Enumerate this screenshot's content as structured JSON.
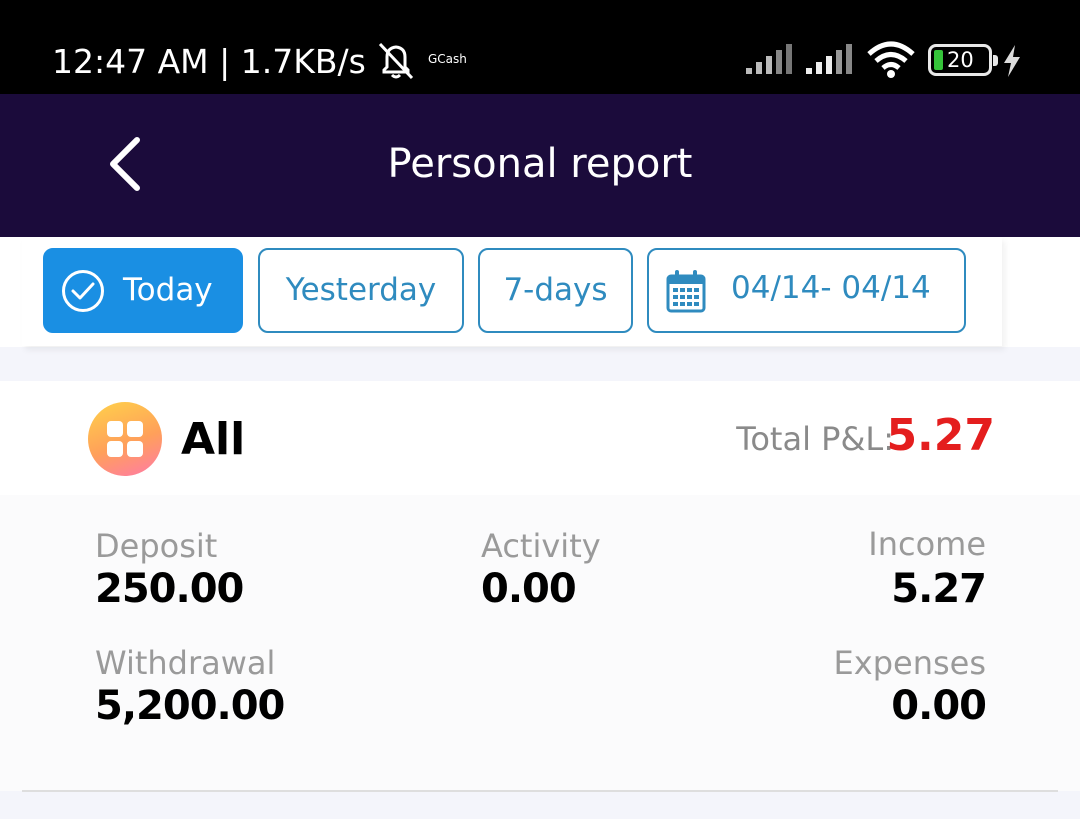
{
  "status_bar": {
    "time_speed": "12:47 AM | 1.7KB/s",
    "app_badge": "GCash",
    "battery_level": "20",
    "icons": [
      "mute-bell-icon",
      "signal-icon",
      "signal-icon",
      "wifi-icon",
      "battery-icon",
      "charging-icon"
    ]
  },
  "header": {
    "title": "Personal report",
    "back_icon": "chevron-left-icon"
  },
  "filters": {
    "today": "Today",
    "yesterday": "Yesterday",
    "seven_days": "7-days",
    "date_range": "04/14- 04/14",
    "selected": "Today"
  },
  "summary": {
    "category": "All",
    "total_label": "Total P&L:",
    "total_value": "5.27",
    "total_color": "#e41e1e",
    "stats": {
      "deposit_label": "Deposit",
      "deposit_value": "250.00",
      "activity_label": "Activity",
      "activity_value": "0.00",
      "income_label": "Income",
      "income_value": "5.27",
      "withdrawal_label": "Withdrawal",
      "withdrawal_value": "5,200.00",
      "expenses_label": "Expenses",
      "expenses_value": "0.00"
    }
  },
  "colors": {
    "header_bg": "#1b0b3b",
    "accent": "#1a8fe3",
    "chip_border": "#2f8bbf"
  }
}
